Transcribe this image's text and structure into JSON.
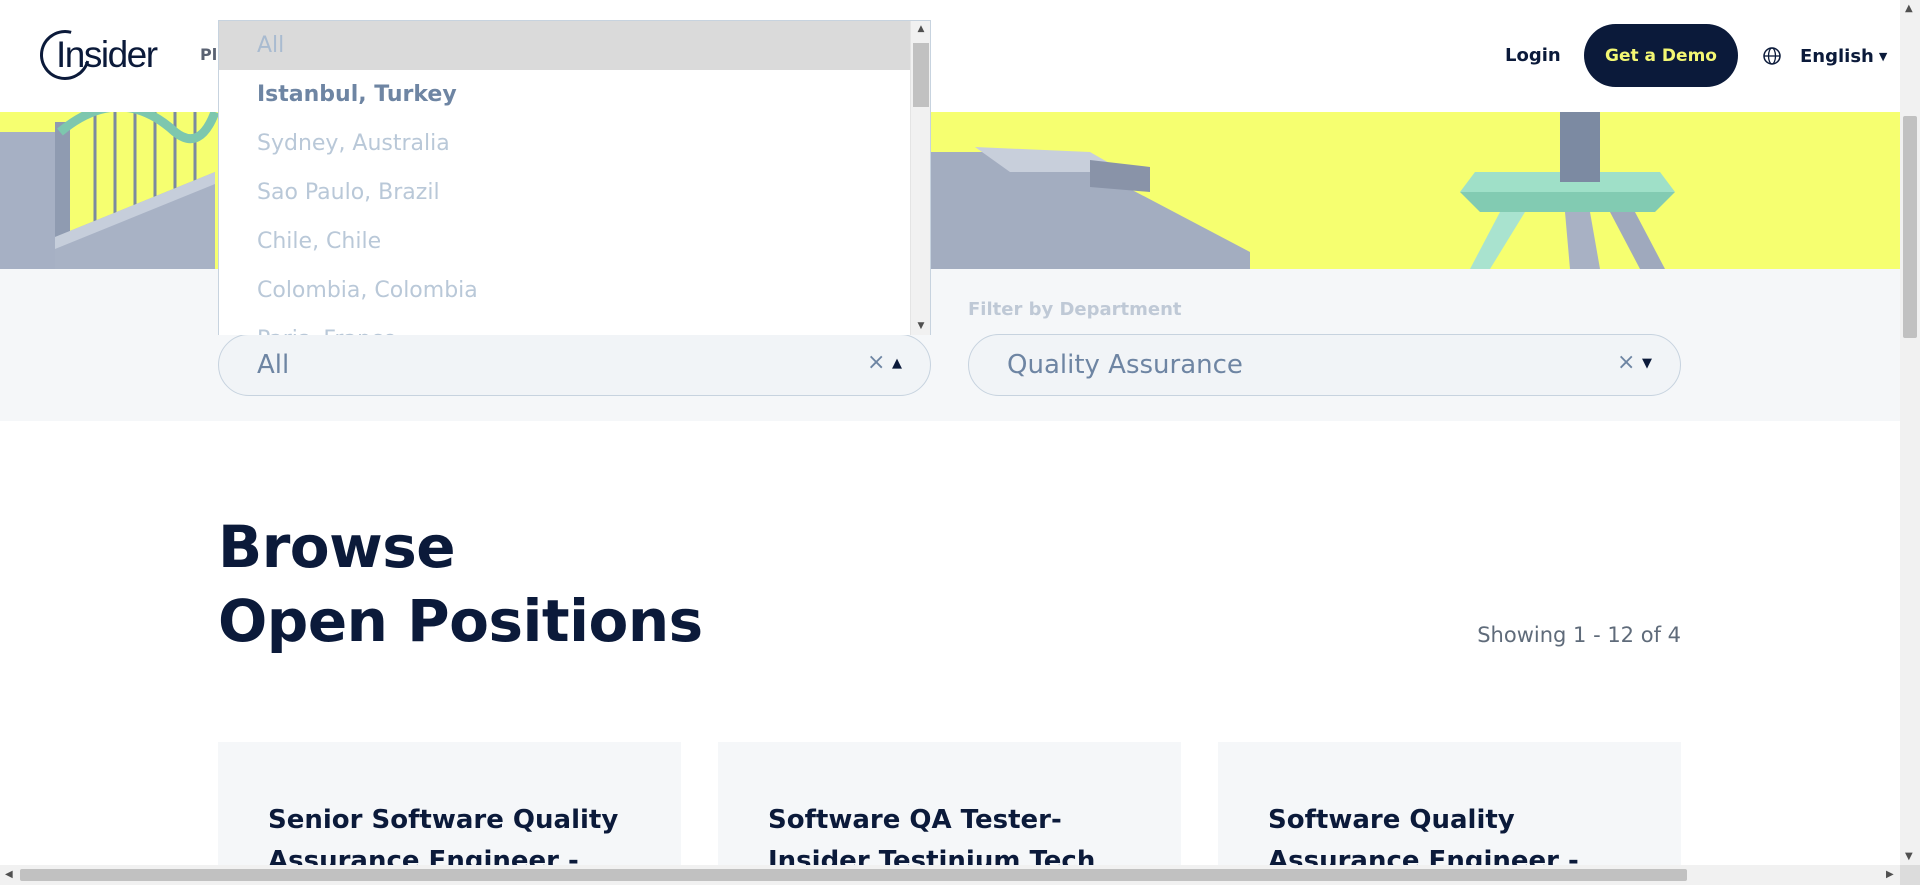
{
  "header": {
    "logo_text": "Insider",
    "nav_partial": "Pl",
    "login_label": "Login",
    "demo_label": "Get a Demo",
    "language_label": "English",
    "language_caret": "▼"
  },
  "filters": {
    "location": {
      "selected": "All",
      "clear_icon": "×",
      "caret_icon": "▲",
      "options": [
        "All",
        "Istanbul, Turkey",
        "Sydney, Australia",
        "Sao Paulo, Brazil",
        "Chile, Chile",
        "Colombia, Colombia",
        "Paris, France"
      ],
      "highlighted_option": "All",
      "active_option": "Istanbul, Turkey"
    },
    "department": {
      "label": "Filter by Department",
      "selected": "Quality Assurance",
      "clear_icon": "×",
      "caret_icon": "▼"
    }
  },
  "main": {
    "title_line1": "Browse",
    "title_line2": "Open Positions",
    "showing_text": "Showing 1 - 12 of 4",
    "jobs": [
      {
        "title_line1": "Senior Software Quality",
        "title_line2": "Assurance Engineer -"
      },
      {
        "title_line1": "Software QA Tester-",
        "title_line2": "Insider Testinium Tech Hub"
      },
      {
        "title_line1": "Software Quality",
        "title_line2": "Assurance Engineer -"
      }
    ]
  },
  "colors": {
    "navy": "#0b1a3a",
    "hero_yellow": "#f6ff70",
    "demo_text": "#f3f773",
    "muted_blue": "#6e85a3"
  }
}
